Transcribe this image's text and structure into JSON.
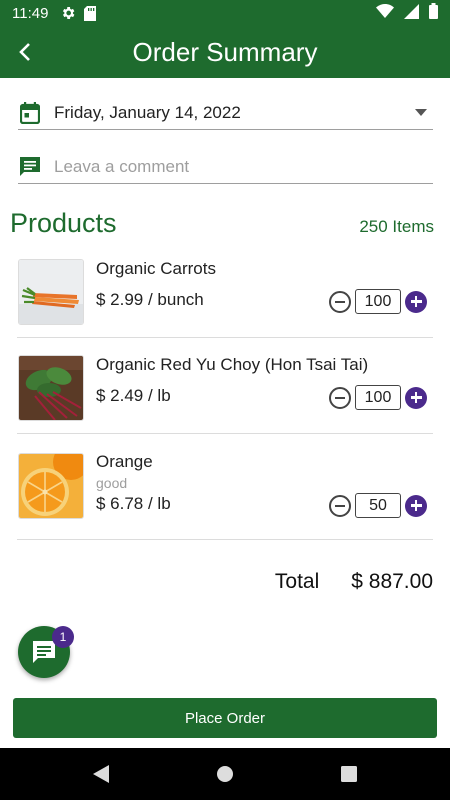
{
  "status_bar": {
    "time": "11:49"
  },
  "app_bar": {
    "title": "Order Summary"
  },
  "date": {
    "value": "Friday, January 14, 2022"
  },
  "comment": {
    "placeholder": "Leava a comment"
  },
  "products_section": {
    "title": "Products",
    "count": "250 Items"
  },
  "products": [
    {
      "name": "Organic Carrots",
      "note": "",
      "price": "$ 2.99 / bunch",
      "quantity": "100",
      "image": "carrots"
    },
    {
      "name": "Organic Red Yu Choy (Hon Tsai Tai)",
      "note": "",
      "price": "$ 2.49 / lb",
      "quantity": "100",
      "image": "red-yu-choy"
    },
    {
      "name": "Orange",
      "note": "good",
      "price": "$ 6.78 / lb",
      "quantity": "50",
      "image": "orange"
    }
  ],
  "total": {
    "label": "Total",
    "value": "$ 887.00"
  },
  "chat": {
    "badge": "1"
  },
  "actions": {
    "place_order": "Place Order"
  },
  "colors": {
    "primary": "#1e6b2e",
    "accent": "#4b2a8c",
    "divider": "#dcdcdc",
    "placeholder": "#9e9e9e"
  },
  "icons": [
    "gear-icon",
    "sd-card-icon",
    "wifi-icon",
    "signal-icon",
    "battery-icon",
    "back-arrow-icon",
    "calendar-icon",
    "comment-icon",
    "dropdown-arrow-icon",
    "minus-icon",
    "plus-icon",
    "chat-icon",
    "nav-back-icon",
    "nav-home-icon",
    "nav-recents-icon"
  ]
}
